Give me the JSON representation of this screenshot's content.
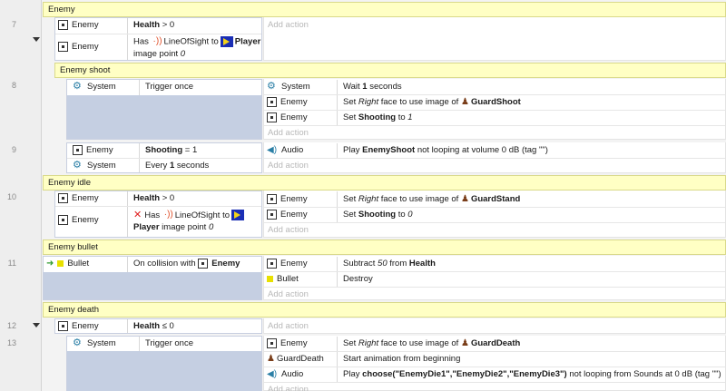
{
  "line_numbers": {
    "e7": "7",
    "e8": "8",
    "e9": "9",
    "e10": "10",
    "e11": "11",
    "e12": "12",
    "e13": "13"
  },
  "groups": {
    "enemy": "Enemy",
    "enemy_shoot": "Enemy shoot",
    "enemy_idle": "Enemy idle",
    "enemy_bullet": "Enemy bullet",
    "enemy_death": "Enemy death"
  },
  "common": {
    "enemy": "Enemy",
    "system": "System",
    "audio": "Audio",
    "bullet": "Bullet",
    "guard_death": "GuardDeath",
    "add_action": "Add action",
    "player": "Player",
    "line_of_sight": "LineOfSight",
    "has": "Has",
    "to": "to",
    "image_point_text": "image point",
    "zero": "0",
    "one": "1",
    "health": "Health"
  },
  "e7": {
    "c1_cmp": "> 0"
  },
  "e8": {
    "cond": "Trigger once",
    "a1_pre": "Wait",
    "a1_num": "1",
    "a1_post": "seconds",
    "a2_pre": "Set",
    "a2_face": "Right",
    "a2_mid": "face to use image of",
    "a2_img": "GuardShoot",
    "a3_pre": "Set",
    "a3_var": "Shooting",
    "a3_mid": "to",
    "a3_val": "1"
  },
  "e9": {
    "c1_var": "Shooting",
    "c1_cmp": "= 1",
    "c2_pre": "Every",
    "c2_num": "1",
    "c2_post": "seconds",
    "a1_pre": "Play",
    "a1_sound": "EnemyShoot",
    "a1_post": "not looping at volume 0 dB (tag \"\")"
  },
  "e10": {
    "c1_cmp": "> 0",
    "a1_img": "GuardStand",
    "a2_val": "0"
  },
  "e11": {
    "c1_pre": "On collision with",
    "a1_pre": "Subtract",
    "a1_num": "50",
    "a1_mid": "from",
    "a2": "Destroy"
  },
  "e12": {
    "c1_cmp": "≤ 0"
  },
  "e13": {
    "cond": "Trigger once",
    "a1_img": "GuardDeath",
    "a2": "Start animation from beginning",
    "a3_pre": "Play",
    "a3_expr": "choose(\"EnemyDie1\",\"EnemyDie2\",\"EnemyDie3\")",
    "a3_post": "not looping from Sounds at 0 dB (tag \"\")"
  },
  "icons": {
    "object": "object-icon",
    "system": "gear-icon",
    "audio": "speaker-icon",
    "bullet": "yellow-square-icon",
    "trigger": "green-arrow-icon",
    "player": "player-sprite-icon",
    "guard": "guard-sprite-icon",
    "line_of_sight": "signal-icon",
    "invert": "red-x-icon"
  }
}
